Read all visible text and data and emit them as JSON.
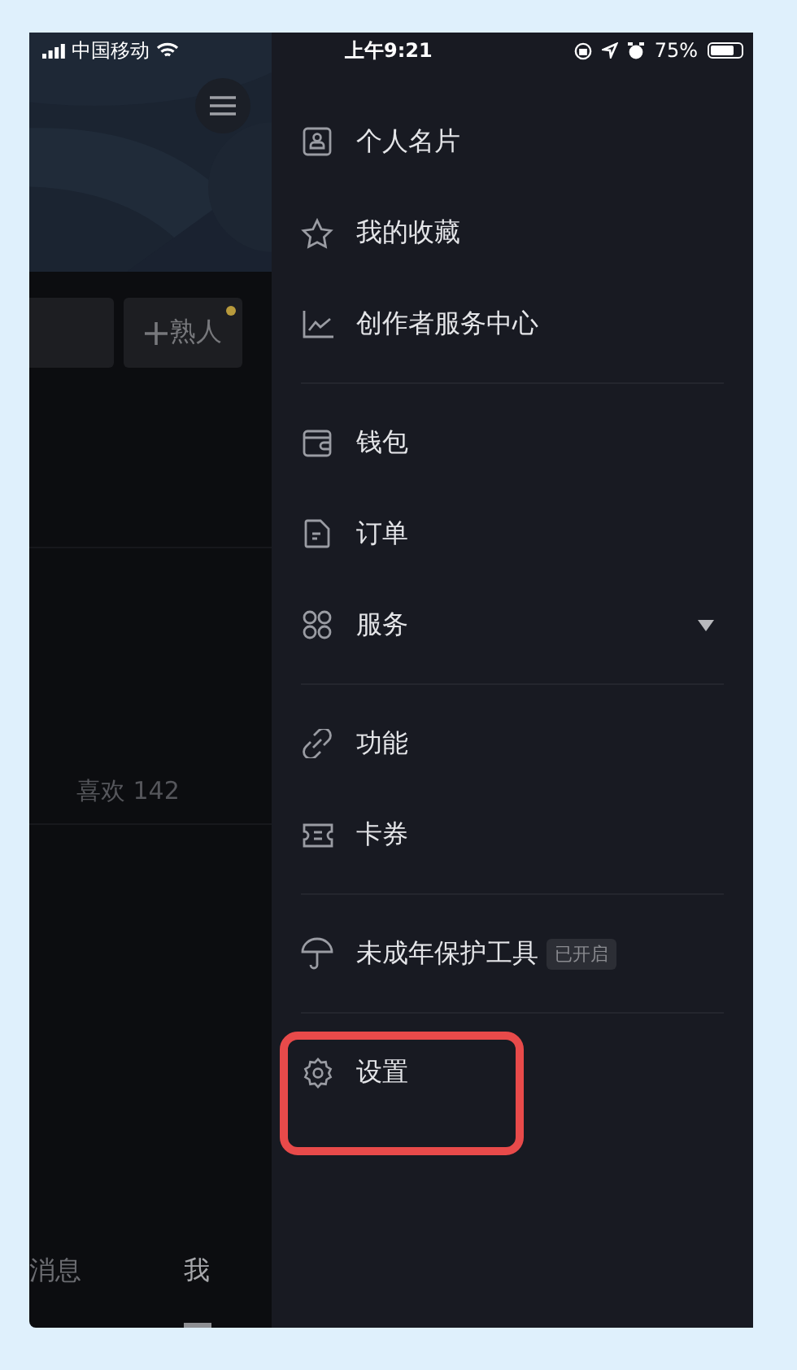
{
  "status_bar": {
    "carrier": "中国移动",
    "time": "上午9:21",
    "battery": "75%"
  },
  "profile": {
    "friend_button": {
      "label": "熟人",
      "has_dot": true
    },
    "likes_tab": "喜欢 142"
  },
  "bottom_tabs": [
    {
      "label": "消息",
      "selected": false
    },
    {
      "label": "我",
      "selected": true
    }
  ],
  "drawer": {
    "sections": [
      [
        {
          "label": "个人名片",
          "highlighted": false
        },
        {
          "label": "我的收藏",
          "highlighted": false
        },
        {
          "label": "创作者服务中心",
          "highlighted": false
        }
      ],
      [
        {
          "label": "钱包",
          "highlighted": false
        },
        {
          "label": "订单",
          "highlighted": false
        },
        {
          "label": "服务",
          "expanded": false,
          "highlighted": false
        }
      ],
      [
        {
          "label": "功能",
          "highlighted": false
        },
        {
          "label": "卡券",
          "highlighted": false
        }
      ],
      [
        {
          "label": "未成年保护工具",
          "badge": "已开启",
          "highlighted": false
        }
      ],
      [
        {
          "label": "设置",
          "highlighted": true
        }
      ]
    ]
  }
}
